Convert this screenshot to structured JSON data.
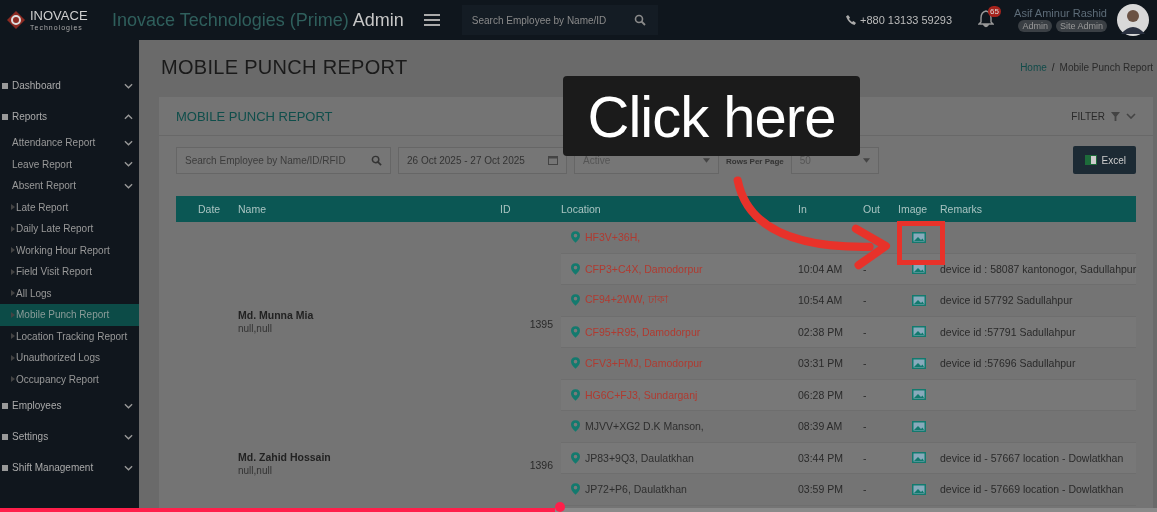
{
  "header": {
    "brand": "INOVACE",
    "brand_sub": "Technologies",
    "title": "Inovace Technologies (Prime)",
    "title_suffix": "Admin",
    "search": {
      "placeholder": "Search Employee by Name/ID"
    },
    "phone": "+880 13133 59293",
    "notifications": "65",
    "user": {
      "name": "Asif Aminur Rashid",
      "roles": [
        "Admin",
        "Site Admin"
      ]
    }
  },
  "sidebar": {
    "items": [
      {
        "label": "Dashboard",
        "kind": "section",
        "expanded": false,
        "selected": false
      },
      {
        "label": "Reports",
        "kind": "section",
        "expanded": true,
        "selected": false
      },
      {
        "label": "Attendance Report",
        "kind": "group",
        "expanded": false,
        "selected": false
      },
      {
        "label": "Leave Report",
        "kind": "group",
        "expanded": false,
        "selected": false
      },
      {
        "label": "Absent Report",
        "kind": "group",
        "expanded": false,
        "selected": false
      },
      {
        "label": "Late Report",
        "kind": "link",
        "selected": false
      },
      {
        "label": "Daily Late Report",
        "kind": "link",
        "selected": false
      },
      {
        "label": "Working Hour Report",
        "kind": "link",
        "selected": false
      },
      {
        "label": "Field Visit Report",
        "kind": "link",
        "selected": false
      },
      {
        "label": "All Logs",
        "kind": "link",
        "selected": false
      },
      {
        "label": "Mobile Punch Report",
        "kind": "link",
        "selected": true
      },
      {
        "label": "Location Tracking Report",
        "kind": "link",
        "selected": false
      },
      {
        "label": "Unauthorized Logs",
        "kind": "link",
        "selected": false
      },
      {
        "label": "Occupancy Report",
        "kind": "link",
        "selected": false
      },
      {
        "label": "Employees",
        "kind": "section",
        "expanded": false,
        "selected": false
      },
      {
        "label": "Settings",
        "kind": "section",
        "expanded": false,
        "selected": false
      },
      {
        "label": "Shift Management",
        "kind": "section",
        "expanded": false,
        "selected": false
      }
    ]
  },
  "page": {
    "title": "MOBILE PUNCH REPORT",
    "breadcrumb": [
      "Home",
      "Mobile Punch Report"
    ],
    "breadcrumb_separator": "/"
  },
  "card": {
    "title": "MOBILE PUNCH REPORT",
    "filter_label": "FILTER",
    "filters": {
      "search": {
        "placeholder": "Search Employee by Name/ID/RFID"
      },
      "date_range": "26 Oct 2025 - 27 Oct 2025",
      "status": "Active",
      "rows_per_page_label": "Rows Per Page",
      "rows_per_page": "50",
      "export": "Excel"
    },
    "table": {
      "columns": [
        "Date",
        "Name",
        "ID",
        "Location",
        "In",
        "Out",
        "Image",
        "Remarks"
      ],
      "groups": [
        {
          "name": "Md. Munna Mia",
          "sub": "null,null",
          "id": "1395",
          "rows": [
            {
              "location": "HF3V+36H,",
              "color": "#b03a30"
            },
            {
              "location": "CFP3+C4X, Damodorpur",
              "color": "#b03a30",
              "in": "10:04 AM",
              "out": "-",
              "remarks": "device id : 58087 kantonogor, Sadullahpur"
            },
            {
              "location": "CF94+2WW, ঢাকা",
              "color": "#b03a30",
              "in": "10:54 AM",
              "out": "-",
              "remarks": "device id 57792 Sadullahpur"
            },
            {
              "location": "CF95+R95, Damodorpur",
              "color": "#b03a30",
              "in": "02:38 PM",
              "out": "-",
              "remarks": "device id :57791 Sadullahpur"
            },
            {
              "location": "CFV3+FMJ, Damodorpur",
              "color": "#b03a30",
              "in": "03:31 PM",
              "out": "-",
              "remarks": "device id :57696 Sadullahpur"
            },
            {
              "location": "HG6C+FJ3, Sundarganj",
              "color": "#b03a30",
              "in": "06:28 PM",
              "out": "-"
            }
          ]
        },
        {
          "name": "Md. Zahid Hossain",
          "sub": "null,null",
          "id": "1396",
          "rows": [
            {
              "location": "MJVV+XG2 D.K Manson,",
              "color": "#2e2e2e",
              "in": "08:39 AM",
              "out": "-"
            },
            {
              "location": "JP83+9Q3, Daulatkhan",
              "color": "#2e2e2e",
              "in": "03:44 PM",
              "out": "-",
              "remarks": "device id - 57667 location - Dowlatkhan"
            },
            {
              "location": "JP72+P6, Daulatkhan",
              "color": "#2e2e2e",
              "in": "03:59 PM",
              "out": "-",
              "remarks": "device id - 57669 location - Dowlatkhan"
            }
          ]
        }
      ]
    }
  },
  "overlay": {
    "callout": "Click here"
  },
  "video": {
    "progress": {
      "level": 0.48
    }
  }
}
